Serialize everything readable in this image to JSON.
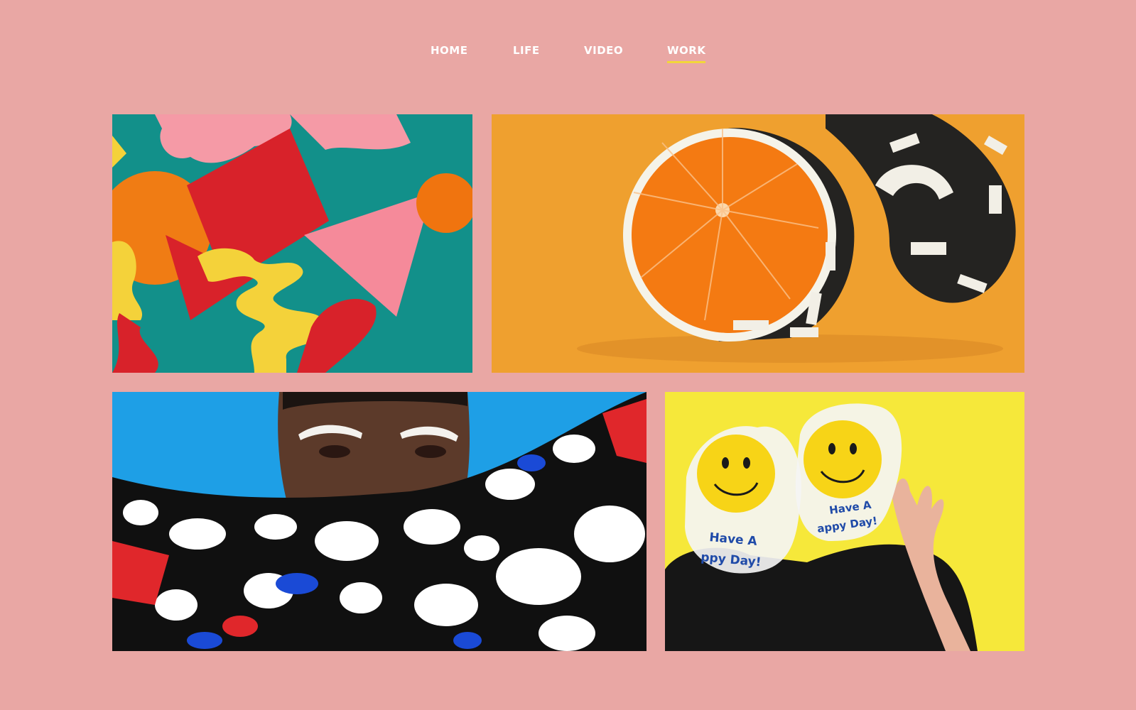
{
  "nav": {
    "items": [
      {
        "label": "HOME",
        "active": false
      },
      {
        "label": "LIFE",
        "active": false
      },
      {
        "label": "VIDEO",
        "active": false
      },
      {
        "label": "WORK",
        "active": true
      }
    ],
    "active_underline_color": "#f2d73a"
  },
  "gallery": {
    "tiles": [
      {
        "name": "paper-shapes-image",
        "background": "#12908a"
      },
      {
        "name": "painted-orange-image",
        "background": "#efa02f"
      },
      {
        "name": "patterned-scarf-portrait-image",
        "background": "#1e9fe6"
      },
      {
        "name": "smiley-bags-image",
        "background": "#f6e83a"
      }
    ],
    "bag_text_line1": "Have A",
    "bag_text_line2_left": "ppy Day!",
    "bag_text_line2_right": "appy Day!"
  },
  "colors": {
    "page_background": "#e9a7a4"
  }
}
